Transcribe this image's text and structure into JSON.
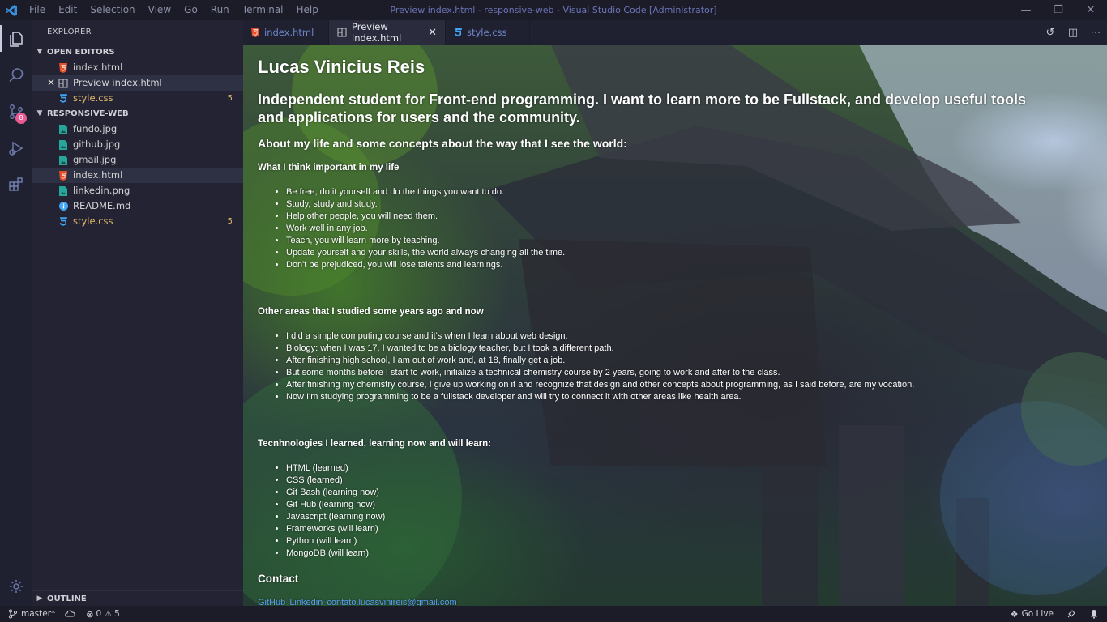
{
  "titlebar": {
    "menu": [
      "File",
      "Edit",
      "Selection",
      "View",
      "Go",
      "Run",
      "Terminal",
      "Help"
    ],
    "title": "Preview index.html - responsive-web - Visual Studio Code [Administrator]"
  },
  "activitybar": {
    "icons": [
      "files-icon",
      "search-icon",
      "source-control-icon",
      "run-debug-icon",
      "extensions-icon"
    ],
    "scm_badge": "8"
  },
  "sidebar": {
    "title": "EXPLORER",
    "open_editors_label": "OPEN EDITORS",
    "open_editors": [
      {
        "label": "index.html",
        "type": "html"
      },
      {
        "label": "Preview index.html",
        "type": "preview"
      },
      {
        "label": "style.css",
        "type": "css",
        "count": "5"
      }
    ],
    "folder_label": "RESPONSIVE-WEB",
    "files": [
      {
        "label": "fundo.jpg",
        "type": "image"
      },
      {
        "label": "github.jpg",
        "type": "image"
      },
      {
        "label": "gmail.jpg",
        "type": "image"
      },
      {
        "label": "index.html",
        "type": "html"
      },
      {
        "label": "linkedin.png",
        "type": "image"
      },
      {
        "label": "README.md",
        "type": "info"
      },
      {
        "label": "style.css",
        "type": "css",
        "count": "5"
      }
    ],
    "outline_label": "OUTLINE"
  },
  "tabs": [
    {
      "label": "index.html",
      "type": "html"
    },
    {
      "label": "Preview index.html",
      "type": "preview",
      "active": true
    },
    {
      "label": "style.css",
      "type": "css"
    }
  ],
  "preview": {
    "name": "Lucas Vinicius Reis",
    "headline": "Independent student for Front-end programming. I want to learn more to be Fullstack, and develop useful tools and applications for users and the community.",
    "about": "About my life and some concepts about the way that I see the world:",
    "important_title": "What I think important in my life",
    "important": [
      "Be free, do it yourself and do the things you want to do.",
      "Study, study and study.",
      "Help other people, you will need them.",
      "Work well in any job.",
      "Teach, you will learn more by teaching.",
      "Update yourself and your skills, the world always changing all the time.",
      "Don't be prejudiced, you will lose talents and learnings."
    ],
    "areas_title": "Other areas that I studied some years ago and now",
    "areas": [
      "I did a simple computing course and it's when I learn about web design.",
      "Biology: when I was 17, I wanted to be a biology teacher, but I took a different path.",
      "After finishing high school, I am out of work and, at 18, finally get a job.",
      "But some months before I start to work, initialize a technical chemistry course by 2 years, going to work and after to the class.",
      "After finishing my chemistry course, I give up working on it and recognize that design and other concepts about programming, as I said before, are my vocation.",
      "Now I'm studying programming to be a fullstack developer and will try to connect it with other areas like health area."
    ],
    "tech_title": "Tecnhnologies I learned, learning now and will learn:",
    "tech": [
      "HTML (learned)",
      "CSS (learned)",
      "Git Bash (learning now)",
      "Git Hub (learning now)",
      "Javascript (learning now)",
      "Frameworks (will learn)",
      "Python (will learn)",
      "MongoDB (will learn)"
    ],
    "contact_title": "Contact",
    "links": [
      "GitHub",
      "Linkedin",
      "contato.lucasvinireis@gmail.com"
    ]
  },
  "statusbar": {
    "branch": "master*",
    "errors": "0",
    "warnings": "5",
    "go_live": "Go Live"
  },
  "colors": {
    "html_icon": "#e44d26",
    "css_icon": "#42a5f5",
    "image_icon": "#26a69a",
    "warning_text": "#e2b96a",
    "link": "#5b9cf5"
  }
}
